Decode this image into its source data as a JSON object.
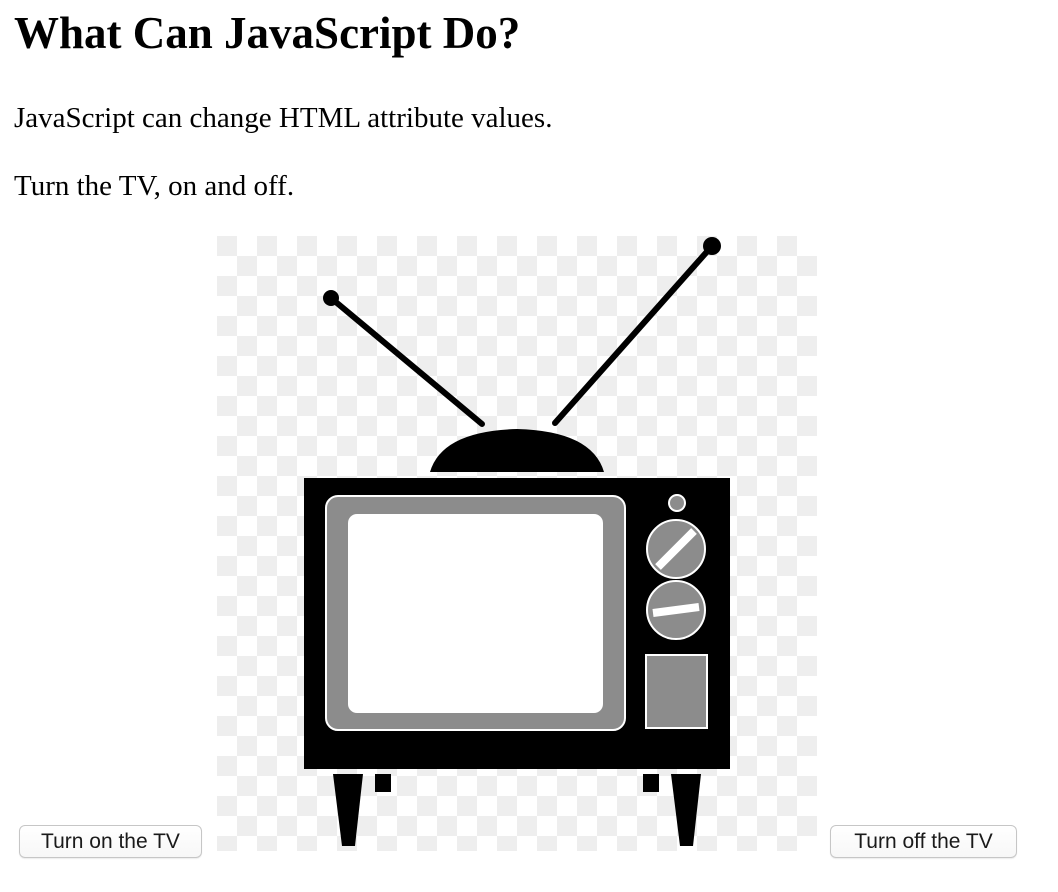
{
  "page": {
    "heading": "What Can JavaScript Do?",
    "paragraph_1": "JavaScript can change HTML attribute values.",
    "paragraph_2": "Turn the TV, on and off."
  },
  "controls": {
    "turn_on_label": "Turn on the TV",
    "turn_off_label": "Turn off the TV"
  },
  "image": {
    "subject": "tv-icon",
    "state": "off"
  },
  "colors": {
    "tv_body": "#000000",
    "screen": "#ffffff",
    "bezel": "#8c8c8c",
    "checker_light": "#ffffff",
    "checker_dark": "#eeeeee"
  }
}
